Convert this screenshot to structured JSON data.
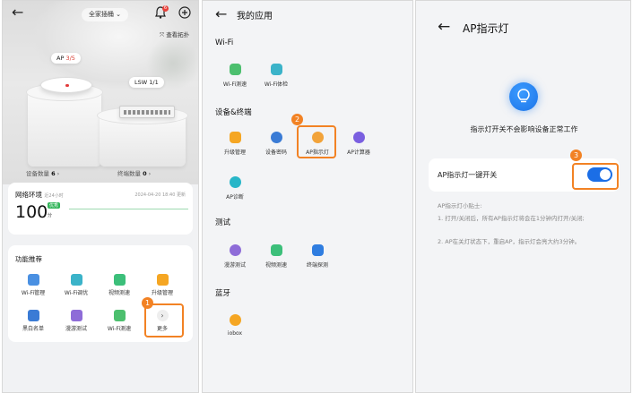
{
  "panel1": {
    "home_label": "全家插桶 ⌄",
    "notification_count": "6",
    "topology_label": "查看拓扑",
    "ap_tag_prefix": "AP ",
    "ap_tag_num": "3/5",
    "lsw_tag": "LSW 1/1",
    "device_count_label": "设备数量",
    "device_count": "6",
    "terminal_count_label": "终端数量",
    "terminal_count": "0",
    "network_title": "网络环境",
    "network_sub": "近24小时",
    "network_time": "2024-04-20 18:40 更新",
    "score": "100",
    "score_badge": "优秀",
    "score_unit": "分",
    "function_title": "功能推荐",
    "functions": [
      {
        "label": "Wi-Fi管理",
        "color": "#4a90e2"
      },
      {
        "label": "Wi-Fi调优",
        "color": "#3bb3c9"
      },
      {
        "label": "视频测速",
        "color": "#3cbf7a"
      },
      {
        "label": "升级管理",
        "color": "#f5a623"
      },
      {
        "label": "黑白名单",
        "color": "#3a7bd5"
      },
      {
        "label": "漫游测试",
        "color": "#8e6cd8"
      },
      {
        "label": "Wi-Fi测速",
        "color": "#4cbf6e"
      },
      {
        "label": "更多",
        "color": "#eeeeee"
      }
    ],
    "more_glyph": "›",
    "step": "1"
  },
  "panel2": {
    "title": "我的应用",
    "sections": {
      "wifi": "Wi-Fi",
      "device": "设备&终端",
      "test": "测试",
      "bluetooth": "蓝牙"
    },
    "wifi_apps": [
      "Wi-Fi测速",
      "Wi-Fi体检"
    ],
    "device_apps": [
      "升级管理",
      "设备密码",
      "AP指示灯",
      "AP计算器",
      "AP诊断"
    ],
    "test_apps": [
      "漫游测试",
      "视频测速",
      "终端探测"
    ],
    "bt_apps": [
      "iobox"
    ],
    "step": "2"
  },
  "panel3": {
    "title": "AP指示灯",
    "subtitle": "指示灯开关不会影响设备正常工作",
    "switch_label": "AP指示灯一键开关",
    "toggle_state": "on",
    "tips_title": "AP指示灯小贴士:",
    "tip1": "1. 打开/关闭后，所有AP指示灯将会在1分钟内打开/关闭;",
    "tip2": "2. AP在关灯状态下，重启AP，指示灯会亮大约3分钟。",
    "step": "3",
    "accent": "#1b6ee6"
  }
}
